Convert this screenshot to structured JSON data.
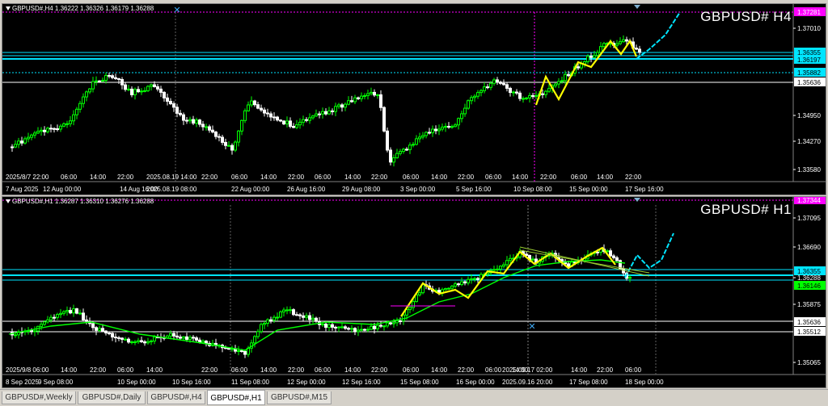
{
  "top_chart": {
    "ohlc": "GBPUSD#,H4  1.36222 1.36326 1.36179 1.36288",
    "symbol": "GBPUSD# H4",
    "price_labels": [
      {
        "text": "1.37281",
        "kind": "magenta"
      },
      {
        "text": "1.37010",
        "kind": "plain"
      },
      {
        "text": "1.36355",
        "kind": "cyan"
      },
      {
        "text": "1.36197",
        "kind": "cyan"
      },
      {
        "text": "1.35882",
        "kind": "cyan"
      },
      {
        "text": "1.35636",
        "kind": "white"
      },
      {
        "text": "1.34950",
        "kind": "plain"
      },
      {
        "text": "1.34270",
        "kind": "plain"
      },
      {
        "text": "1.33580",
        "kind": "plain"
      }
    ],
    "time_upper": [
      "2025/8/7 22:00",
      "06:00",
      "14:00",
      "22:00",
      "2025.08.19 14:00",
      "22:00",
      "06:00",
      "14:00",
      "22:00",
      "06:00",
      "14:00",
      "22:00",
      "06:00",
      "14:00",
      "22:00",
      "06:00",
      "14:00",
      "22:00",
      "06:00",
      "14:00",
      "22:00"
    ],
    "time_lower": [
      "7 Aug 2025",
      "12 Aug 00:00",
      "14 Aug 16:00",
      "2025.08.19 08:00",
      "22 Aug 00:00",
      "26 Aug 16:00",
      "29 Aug 08:00",
      "3 Sep 00:00",
      "5 Sep 16:00",
      "10 Sep 08:00",
      "15 Sep 00:00",
      "17 Sep 16:00"
    ]
  },
  "bottom_chart": {
    "ohlc": "GBPUSD#,H1  1.36287 1.36310 1.36276 1.36288",
    "symbol": "GBPUSD# H1",
    "price_labels": [
      {
        "text": "1.37344",
        "kind": "magenta"
      },
      {
        "text": "1.37095",
        "kind": "plain"
      },
      {
        "text": "1.36690",
        "kind": "plain"
      },
      {
        "text": "1.36355",
        "kind": "cyan"
      },
      {
        "text": "1.36288",
        "kind": "plain"
      },
      {
        "text": "1.36146",
        "kind": "green"
      },
      {
        "text": "1.35875",
        "kind": "plain"
      },
      {
        "text": "1.35636",
        "kind": "white"
      },
      {
        "text": "1.35512",
        "kind": "white"
      },
      {
        "text": "1.35065",
        "kind": "plain"
      }
    ],
    "time_upper": [
      "2025/9/8 06:00",
      "14:00",
      "22:00",
      "06:00",
      "14:00",
      "22:00",
      "06:00",
      "14:00",
      "22:00",
      "06:00",
      "14:00",
      "22:00",
      "06:00",
      "14:00",
      "22:00",
      "06:00",
      "14:00",
      "2025.09.17 02:00",
      "14:00",
      "22:00",
      "06:00"
    ],
    "time_lower": [
      "8 Sep 2025",
      "9 Sep 08:00",
      "10 Sep 00:00",
      "10 Sep 16:00",
      "11 Sep 08:00",
      "12 Sep 00:00",
      "12 Sep 16:00",
      "15 Sep 08:00",
      "16 Sep 00:00",
      "2025.09.16 20:00",
      "17 Sep 08:00",
      "18 Sep 00:00"
    ]
  },
  "colors": {
    "bull": "#00ff00",
    "bear": "#ffffff",
    "cyan": "#00e5ff",
    "yellow": "#ffff00",
    "magenta": "#ff00ff",
    "ma": "#00ff00",
    "grid": "#404040"
  },
  "tabs": [
    {
      "label": "GBPUSD#,Weekly",
      "active": false
    },
    {
      "label": "GBPUSD#,Daily",
      "active": false
    },
    {
      "label": "GBPUSD#,H4",
      "active": false
    },
    {
      "label": "GBPUSD#,H1",
      "active": true
    },
    {
      "label": "GBPUSD#,M15",
      "active": false
    }
  ]
}
